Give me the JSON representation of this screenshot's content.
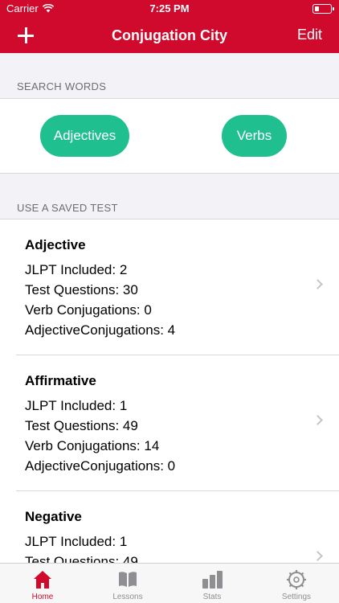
{
  "status_bar": {
    "carrier": "Carrier",
    "time": "7:25 PM"
  },
  "nav": {
    "title": "Conjugation City",
    "edit_label": "Edit",
    "add_icon": "plus-icon"
  },
  "search_section": {
    "header": "SEARCH WORDS",
    "buttons": [
      {
        "label": "Adjectives"
      },
      {
        "label": "Verbs"
      }
    ],
    "accent_color": "#1fbf8f"
  },
  "saved_section": {
    "header": "USE A SAVED TEST",
    "tests": [
      {
        "name": "Adjective",
        "jlpt": "JLPT Included: 2",
        "questions": "Test Questions: 30",
        "verb": "Verb Conjugations: 0",
        "adjective": "AdjectiveConjugations: 4"
      },
      {
        "name": "Affirmative",
        "jlpt": "JLPT Included: 1",
        "questions": "Test Questions: 49",
        "verb": "Verb Conjugations: 14",
        "adjective": "AdjectiveConjugations: 0"
      },
      {
        "name": "Negative",
        "jlpt": "JLPT Included: 1",
        "questions": "Test Questions: 49",
        "verb": "",
        "adjective": ""
      }
    ]
  },
  "tab_bar": {
    "tabs": [
      {
        "label": "Home",
        "icon": "home-icon",
        "active": true
      },
      {
        "label": "Lessons",
        "icon": "book-icon",
        "active": false
      },
      {
        "label": "Stats",
        "icon": "bar-chart-icon",
        "active": false
      },
      {
        "label": "Settings",
        "icon": "gear-icon",
        "active": false
      }
    ]
  },
  "brand_color": "#cf0a2c"
}
